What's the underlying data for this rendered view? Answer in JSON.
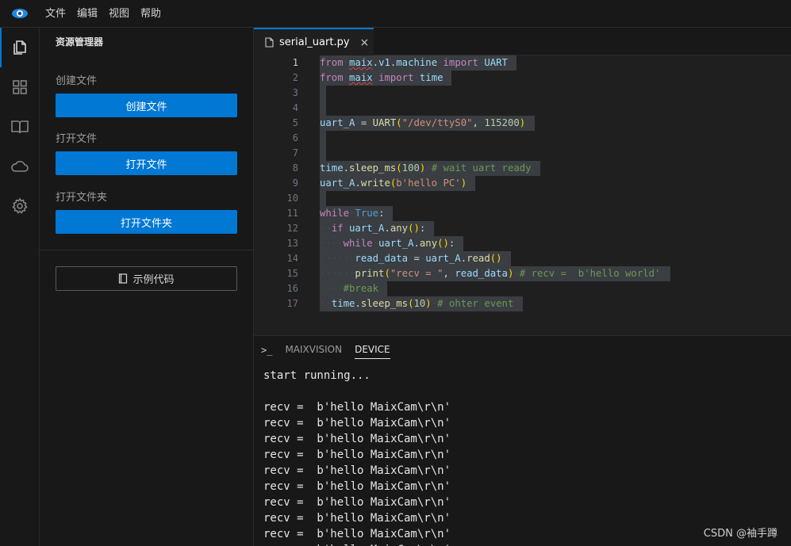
{
  "menubar": {
    "items": [
      "文件",
      "编辑",
      "视图",
      "帮助"
    ]
  },
  "activitybar": {
    "icons": [
      "files-icon",
      "extensions-icon",
      "book-icon",
      "cloud-icon",
      "gear-icon"
    ],
    "active_index": 0
  },
  "sidebar": {
    "title": "资源管理器",
    "create_file_label": "创建文件",
    "create_file_button": "创建文件",
    "open_file_label": "打开文件",
    "open_file_button": "打开文件",
    "open_folder_label": "打开文件夹",
    "open_folder_button": "打开文件夹",
    "examples_button": "示例代码"
  },
  "editor": {
    "tab_title": "serial_uart.py",
    "tab_close": "×",
    "current_line": 1,
    "line_numbers": [
      "1",
      "2",
      "3",
      "4",
      "5",
      "6",
      "7",
      "8",
      "9",
      "10",
      "11",
      "12",
      "13",
      "14",
      "15",
      "16",
      "17"
    ],
    "lines": [
      "from maix.v1.machine import UART",
      "from maix import time",
      "",
      "",
      "uart_A = UART(\"/dev/ttyS0\", 115200)",
      "",
      "",
      "time.sleep_ms(100) # wait uart ready",
      "uart_A.write(b'hello PC')",
      "",
      "while True:",
      "  if uart_A.any():",
      "    while uart_A.any():",
      "      read_data = uart_A.read()",
      "      print(\"recv = \", read_data) # recv =  b'hello world'",
      "    #break",
      "  time.sleep_ms(10) # ohter event"
    ]
  },
  "panel": {
    "prompt_symbol": ">_",
    "tabs": [
      "MAIXVISION",
      "DEVICE"
    ],
    "active_tab": "DEVICE",
    "terminal_lines": [
      "start running...",
      "",
      "recv =  b'hello MaixCam\\r\\n'",
      "recv =  b'hello MaixCam\\r\\n'",
      "recv =  b'hello MaixCam\\r\\n'",
      "recv =  b'hello MaixCam\\r\\n'",
      "recv =  b'hello MaixCam\\r\\n'",
      "recv =  b'hello MaixCam\\r\\n'",
      "recv =  b'hello MaixCam\\r\\n'",
      "recv =  b'hello MaixCam\\r\\n'",
      "recv =  b'hello MaixCam\\r\\n'",
      "recv =  b'hello MaixCam\\r\\n'"
    ]
  },
  "watermark": "CSDN @袖手蹲",
  "colors": {
    "accent": "#0078d4",
    "background": "#1e1e1e",
    "sidebar": "#181818"
  }
}
